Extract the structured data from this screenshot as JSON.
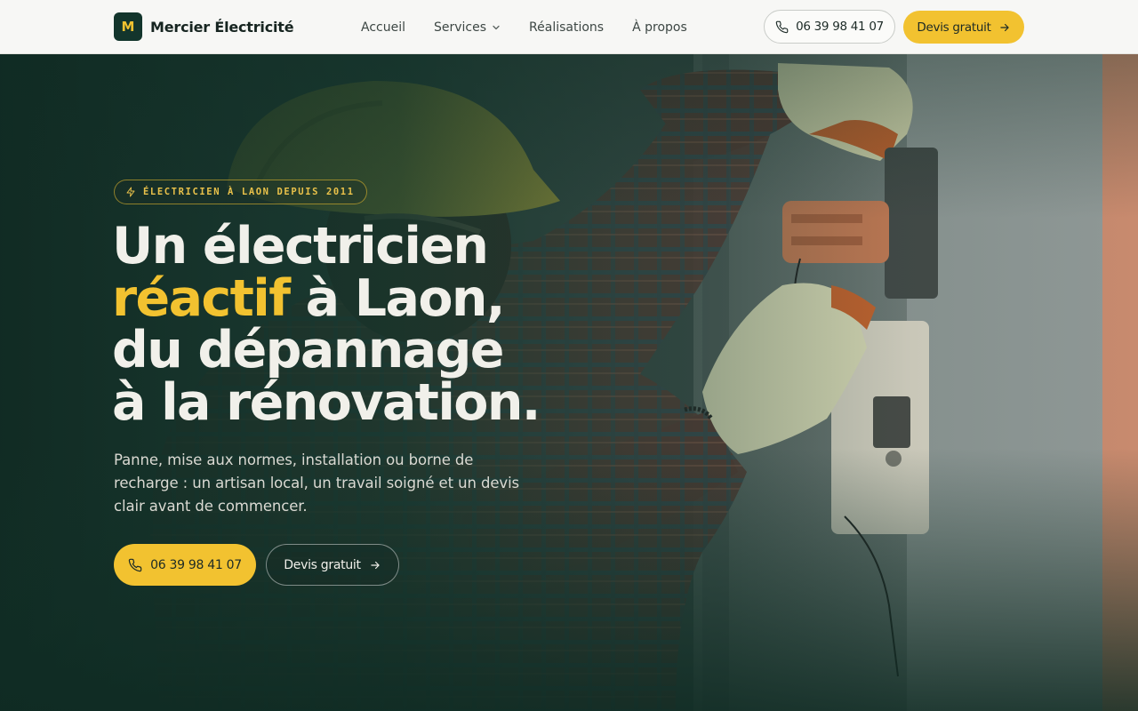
{
  "brand": {
    "mark": "M",
    "name": "Mercier Électricité"
  },
  "nav": {
    "items": [
      {
        "label": "Accueil"
      },
      {
        "label": "Services",
        "has_dropdown": true
      },
      {
        "label": "Réalisations"
      },
      {
        "label": "À propos"
      }
    ]
  },
  "header_actions": {
    "phone_label": "06 39 98 41 07",
    "quote_label": "Devis gratuit"
  },
  "hero": {
    "badge": "ÉLECTRICIEN À LAON DEPUIS 2011",
    "headline": {
      "line1": "Un électricien",
      "accent": "réactif",
      "line2_rest": " à Laon,",
      "line3": "du dépannage",
      "line4": "à la rénovation."
    },
    "lede": "Panne, mise aux normes, installation ou borne de recharge : un artisan local, un travail soigné et un devis clair avant de commencer.",
    "cta_phone": "06 39 98 41 07",
    "cta_quote": "Devis gratuit",
    "image_icon": "electrician-at-panel-photo"
  },
  "colors": {
    "accent": "#f2c230",
    "brand_dark": "#13352c",
    "header_bg": "#f7f7f5",
    "hero_overlay": "#163a30"
  }
}
